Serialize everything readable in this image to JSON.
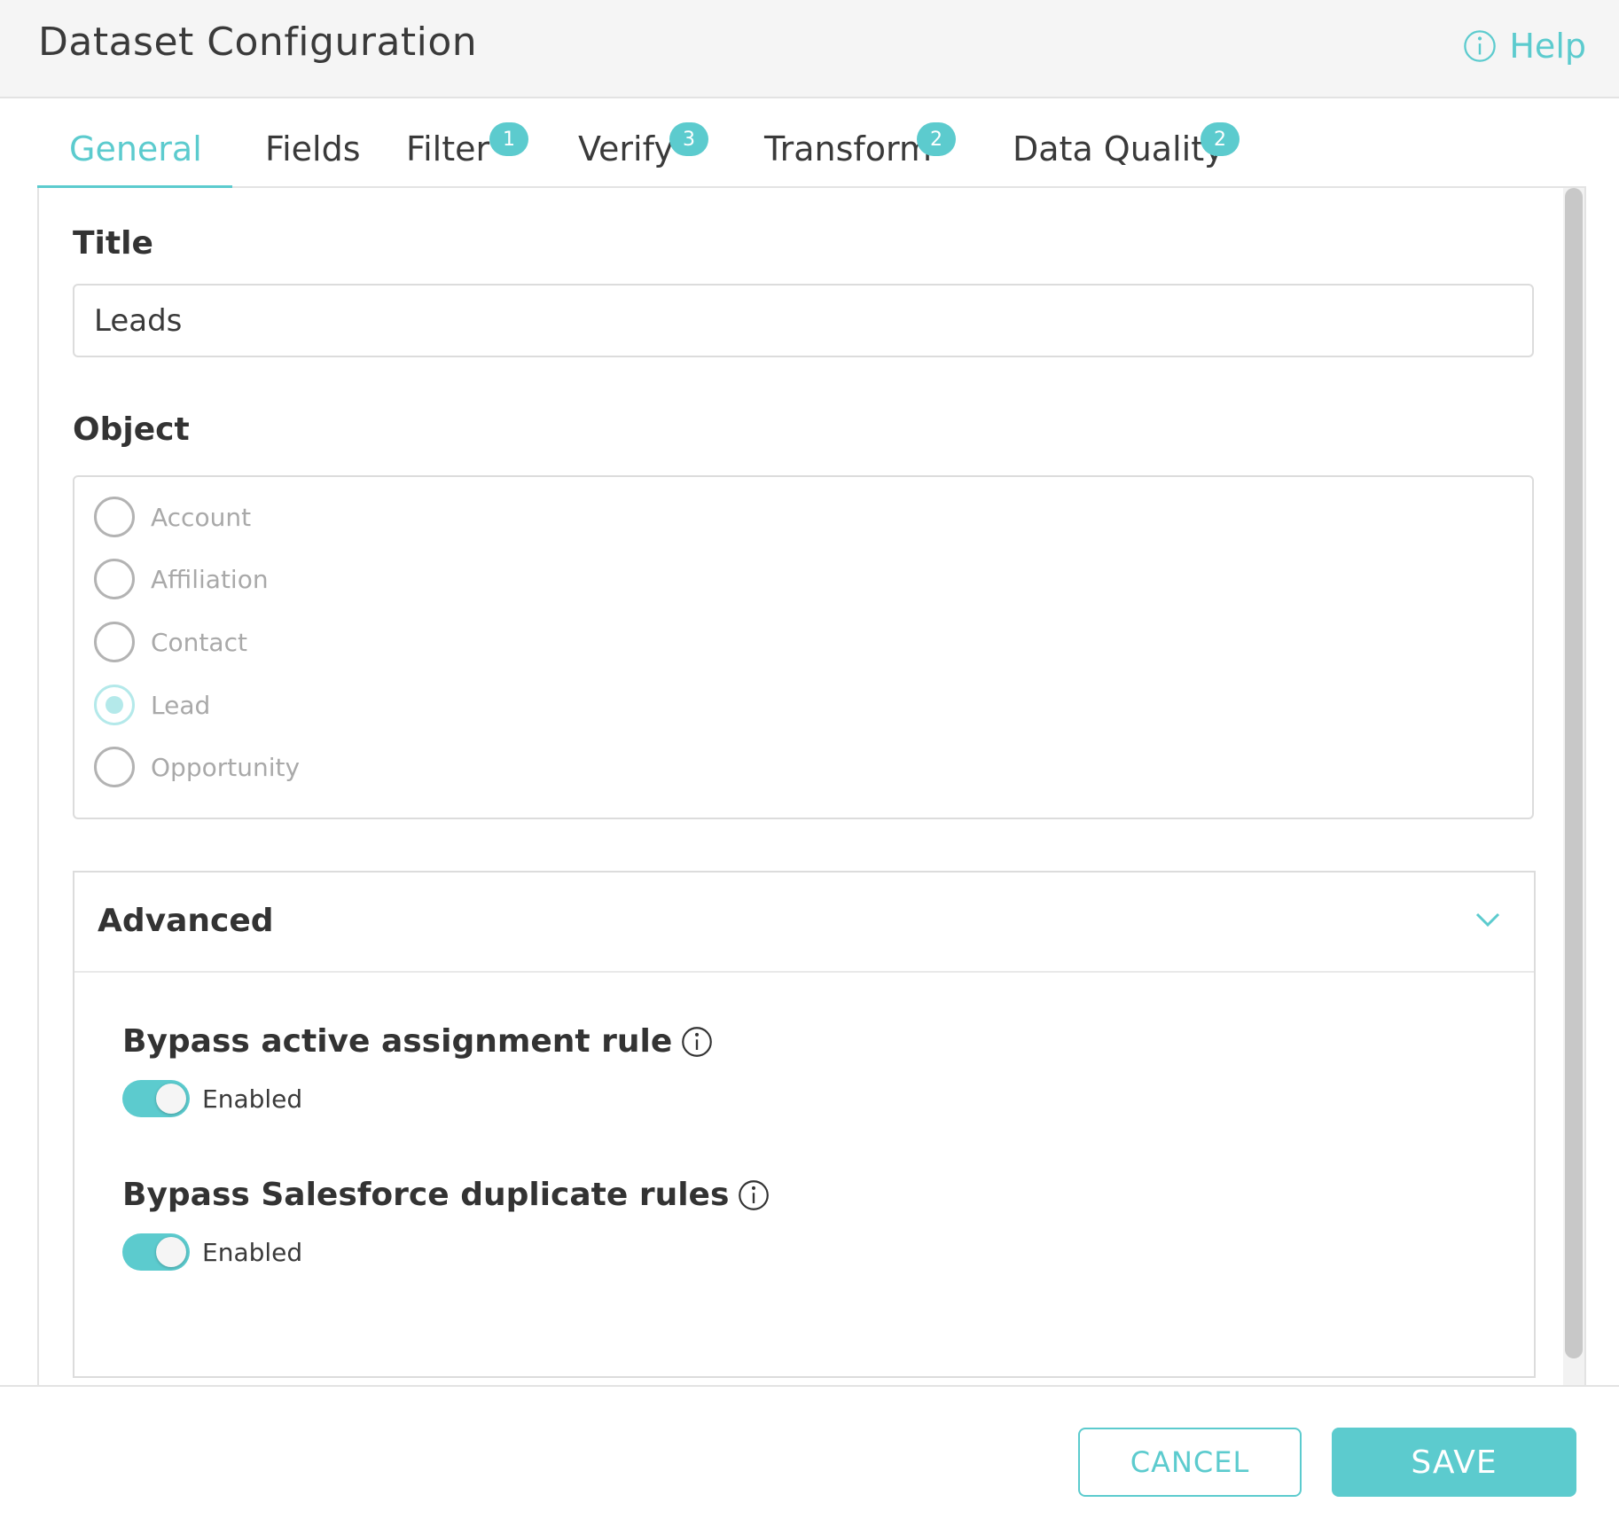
{
  "header": {
    "title": "Dataset Configuration",
    "help_label": "Help",
    "help_icon": "info-circle-icon"
  },
  "tabs": [
    {
      "label": "General",
      "badge": "",
      "active": true
    },
    {
      "label": "Fields",
      "badge": ""
    },
    {
      "label": "Filter",
      "badge": "1"
    },
    {
      "label": "Verify",
      "badge": "3"
    },
    {
      "label": "Transform",
      "badge": "2"
    },
    {
      "label": "Data Quality",
      "badge": "2"
    }
  ],
  "general": {
    "title_label": "Title",
    "title_value": "Leads",
    "object_label": "Object",
    "object_options": [
      {
        "label": "Account",
        "selected": false
      },
      {
        "label": "Affiliation",
        "selected": false
      },
      {
        "label": "Contact",
        "selected": false
      },
      {
        "label": "Lead",
        "selected": true
      },
      {
        "label": "Opportunity",
        "selected": false
      }
    ]
  },
  "advanced": {
    "title": "Advanced",
    "settings": [
      {
        "label": "Bypass active assignment rule",
        "toggle_text": "Enabled",
        "enabled": true
      },
      {
        "label": "Bypass Salesforce duplicate rules",
        "toggle_text": "Enabled",
        "enabled": true
      }
    ]
  },
  "footer": {
    "cancel_label": "CANCEL",
    "save_label": "SAVE"
  },
  "colors": {
    "accent": "#5ccbce",
    "text": "#3a3a3a",
    "muted": "#a9a9a9",
    "border": "#dcdcdc"
  }
}
